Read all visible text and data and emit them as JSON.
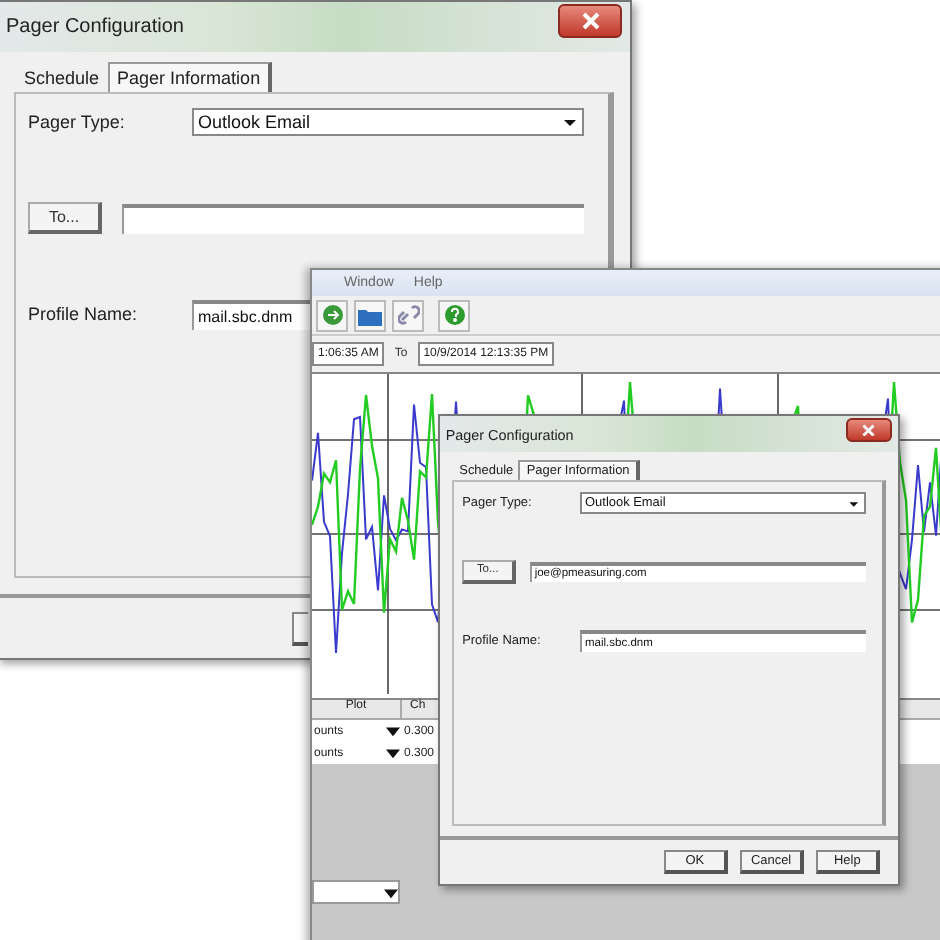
{
  "dialog": {
    "title": "Pager Configuration",
    "tabs": [
      {
        "label": "Schedule",
        "selected": false
      },
      {
        "label": "Pager Information",
        "selected": true
      }
    ],
    "pager_type_label": "Pager Type:",
    "pager_type": "Outlook Email",
    "to_button": "To...",
    "profile_label": "Profile Name:",
    "profile_name": "mail.sbc.dnm"
  },
  "app_window": {
    "menu": [
      "Window",
      "Help"
    ],
    "from_time": "1:06:35 AM",
    "to_label": "To",
    "to_time": "10/9/2014 12:13:35 PM",
    "table": {
      "columns": [
        "Plot",
        "Ch"
      ],
      "rows": [
        {
          "cells": [
            "ounts",
            "0.300"
          ]
        },
        {
          "cells": [
            "ounts",
            "0.300"
          ]
        }
      ]
    }
  },
  "inner_dialog": {
    "title": "Pager Configuration",
    "tabs": [
      {
        "label": "Schedule",
        "selected": false
      },
      {
        "label": "Pager Information",
        "selected": true
      }
    ],
    "pager_type_label": "Pager Type:",
    "pager_type": "Outlook Email",
    "to_button": "To...",
    "to_value": "joe@pmeasuring.com",
    "profile_label": "Profile Name:",
    "profile_name": "mail.sbc.dnm",
    "buttons": [
      "OK",
      "Cancel",
      "Help"
    ]
  }
}
